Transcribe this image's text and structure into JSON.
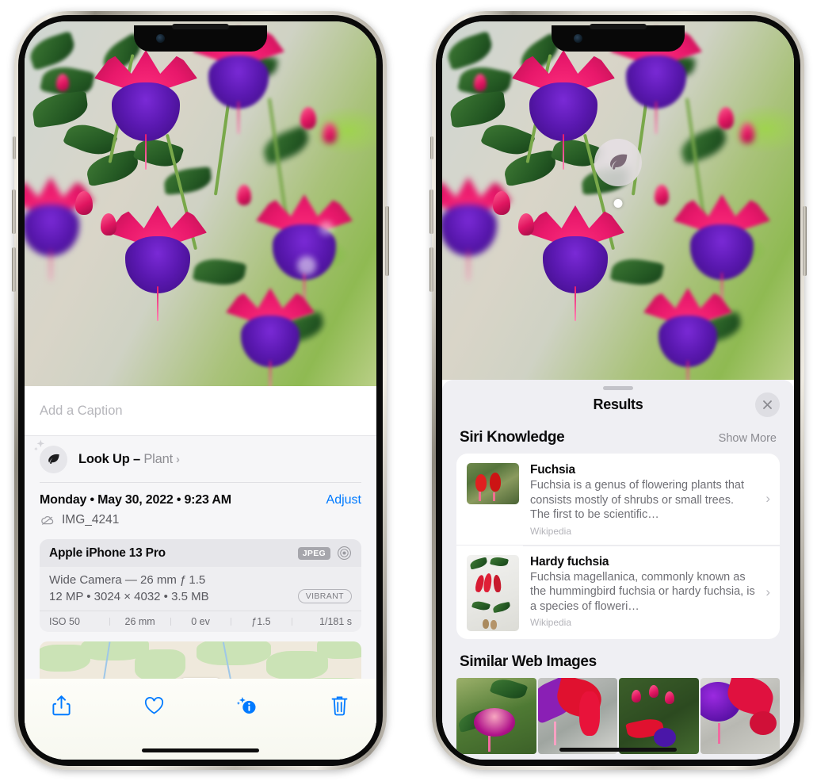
{
  "left_phone": {
    "caption_field": {
      "placeholder": "Add a Caption",
      "value": ""
    },
    "look_up": {
      "label": "Look Up",
      "dash": " – ",
      "subject": "Plant",
      "chevron": "›",
      "icon": "leaf-icon",
      "sparkle_icon": "sparkle-icon"
    },
    "metadata": {
      "date": "Monday • May 30, 2022 • 9:23 AM",
      "adjust_label": "Adjust",
      "filename": "IMG_4241",
      "cloud_icon": "cloud-slash-icon"
    },
    "exif": {
      "device": "Apple iPhone 13 Pro",
      "format_badge": "JPEG",
      "aperture_icon": "aperture-icon",
      "lens_line": "Wide Camera — 26 mm ƒ 1.5",
      "size_line": "12 MP • 3024 × 4032 • 3.5 MB",
      "vibrant_badge": "VIBRANT",
      "stats": [
        "ISO 50",
        "26 mm",
        "0 ev",
        "ƒ1.5",
        "1/181 s"
      ]
    },
    "map": {
      "name": "location-map-thumbnail"
    },
    "toolbar": [
      {
        "name": "share-button",
        "icon": "share-icon"
      },
      {
        "name": "favorite-button",
        "icon": "heart-icon"
      },
      {
        "name": "info-button",
        "icon": "info-sparkle-icon"
      },
      {
        "name": "delete-button",
        "icon": "trash-icon"
      }
    ]
  },
  "right_phone": {
    "visual_lookup_badge": {
      "icon": "leaf-icon"
    },
    "sheet": {
      "title": "Results",
      "close_icon": "close-icon",
      "siri_knowledge": {
        "heading": "Siri Knowledge",
        "show_more": "Show More",
        "items": [
          {
            "name": "Fuchsia",
            "description": "Fuchsia is a genus of flowering plants that consists mostly of shrubs or small trees. The first to be scientific…",
            "source": "Wikipedia",
            "chevron": "›"
          },
          {
            "name": "Hardy fuchsia",
            "description": "Fuchsia magellanica, commonly known as the hummingbird fuchsia or hardy fuchsia, is a species of floweri…",
            "source": "Wikipedia",
            "chevron": "›"
          }
        ]
      },
      "similar_web_images": {
        "heading": "Similar Web Images",
        "count": 4
      }
    }
  },
  "colors": {
    "accent_blue": "#007aff",
    "sheet_background": "#efeff3",
    "card_background": "#ffffff",
    "secondary_text": "#8e8e93",
    "toolbar_background": "#f7f8f0"
  }
}
